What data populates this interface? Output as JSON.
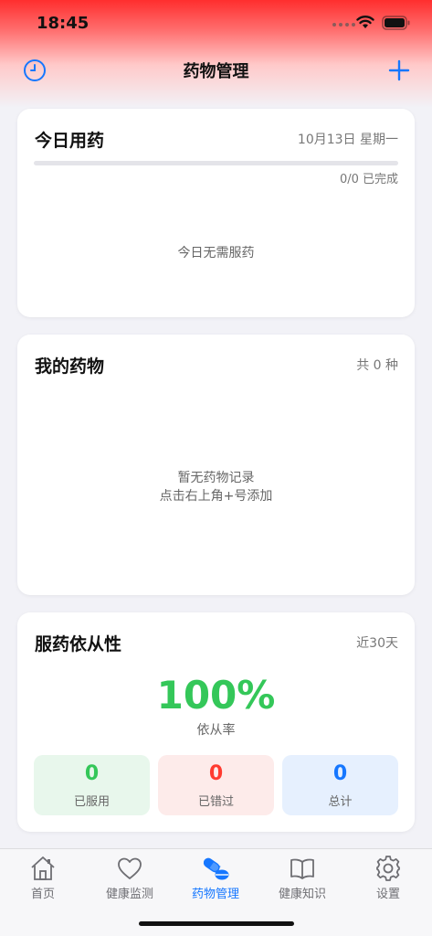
{
  "status_bar": {
    "time": "18:45"
  },
  "nav": {
    "title": "药物管理",
    "history_icon": "clock-icon",
    "add_icon": "plus-icon"
  },
  "today": {
    "title": "今日用药",
    "date": "10月13日 星期一",
    "progress_text": "0/0 已完成",
    "progress_fraction": 0,
    "empty_text": "今日无需服药"
  },
  "my_meds": {
    "title": "我的药物",
    "count_text": "共 0 种",
    "empty_line1": "暂无药物记录",
    "empty_line2": "点击右上角+号添加"
  },
  "adherence": {
    "title": "服药依从性",
    "range_text": "近30天",
    "rate": "100%",
    "rate_label": "依从率",
    "stats": [
      {
        "value": "0",
        "label": "已服用",
        "color": "#34c759",
        "bg": "#e8f7ec"
      },
      {
        "value": "0",
        "label": "已错过",
        "color": "#ff3b30",
        "bg": "#fdebea"
      },
      {
        "value": "0",
        "label": "总计",
        "color": "#1677ff",
        "bg": "#e6f0fe"
      }
    ]
  },
  "tab_bar": {
    "items": [
      {
        "label": "首页",
        "icon": "home-icon"
      },
      {
        "label": "健康监测",
        "icon": "heart-icon"
      },
      {
        "label": "药物管理",
        "icon": "pill-icon"
      },
      {
        "label": "健康知识",
        "icon": "book-icon"
      },
      {
        "label": "设置",
        "icon": "gear-icon"
      }
    ],
    "active_index": 2
  },
  "colors": {
    "accent": "#1677ff",
    "success": "#34c759",
    "danger": "#ff3b30"
  }
}
